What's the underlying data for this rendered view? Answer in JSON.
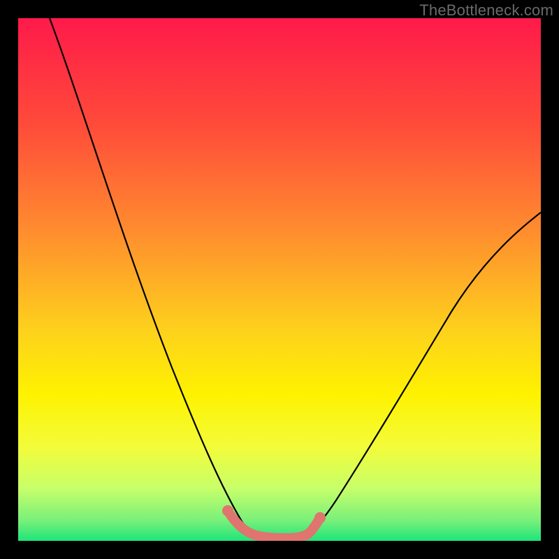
{
  "watermark": "TheBottleneck.com",
  "chart_data": {
    "type": "line",
    "title": "",
    "xlabel": "",
    "ylabel": "",
    "xlim": [
      0,
      100
    ],
    "ylim": [
      0,
      100
    ],
    "grid": false,
    "legend": false,
    "annotations": [],
    "series": [
      {
        "name": "left-curve",
        "x": [
          6,
          10,
          14,
          18,
          22,
          26,
          30,
          33,
          36,
          38,
          40,
          42,
          44
        ],
        "y": [
          100,
          90,
          79,
          67,
          55,
          43,
          32,
          23,
          15,
          10,
          6,
          3,
          1.5
        ]
      },
      {
        "name": "right-curve",
        "x": [
          55,
          57,
          60,
          63,
          66,
          70,
          74,
          78,
          82,
          86,
          90,
          94,
          98,
          100
        ],
        "y": [
          1.5,
          3,
          6,
          10,
          15,
          22,
          29,
          36,
          42,
          48,
          53,
          57,
          61,
          63
        ]
      },
      {
        "name": "bottom-highlight",
        "x": [
          40,
          42,
          44,
          46,
          48,
          50,
          52,
          54,
          55,
          57
        ],
        "y": [
          5.5,
          3,
          1.5,
          1,
          1,
          1,
          1,
          1.2,
          1.5,
          3
        ],
        "stroke": "#e0746f",
        "stroke_width": 10
      }
    ],
    "background_gradient": {
      "top": "#fe1a4a",
      "mid_upper": "#ff8a2f",
      "mid": "#fef200",
      "lower": "#d8ff4a",
      "bottom": "#1ee57a"
    }
  }
}
